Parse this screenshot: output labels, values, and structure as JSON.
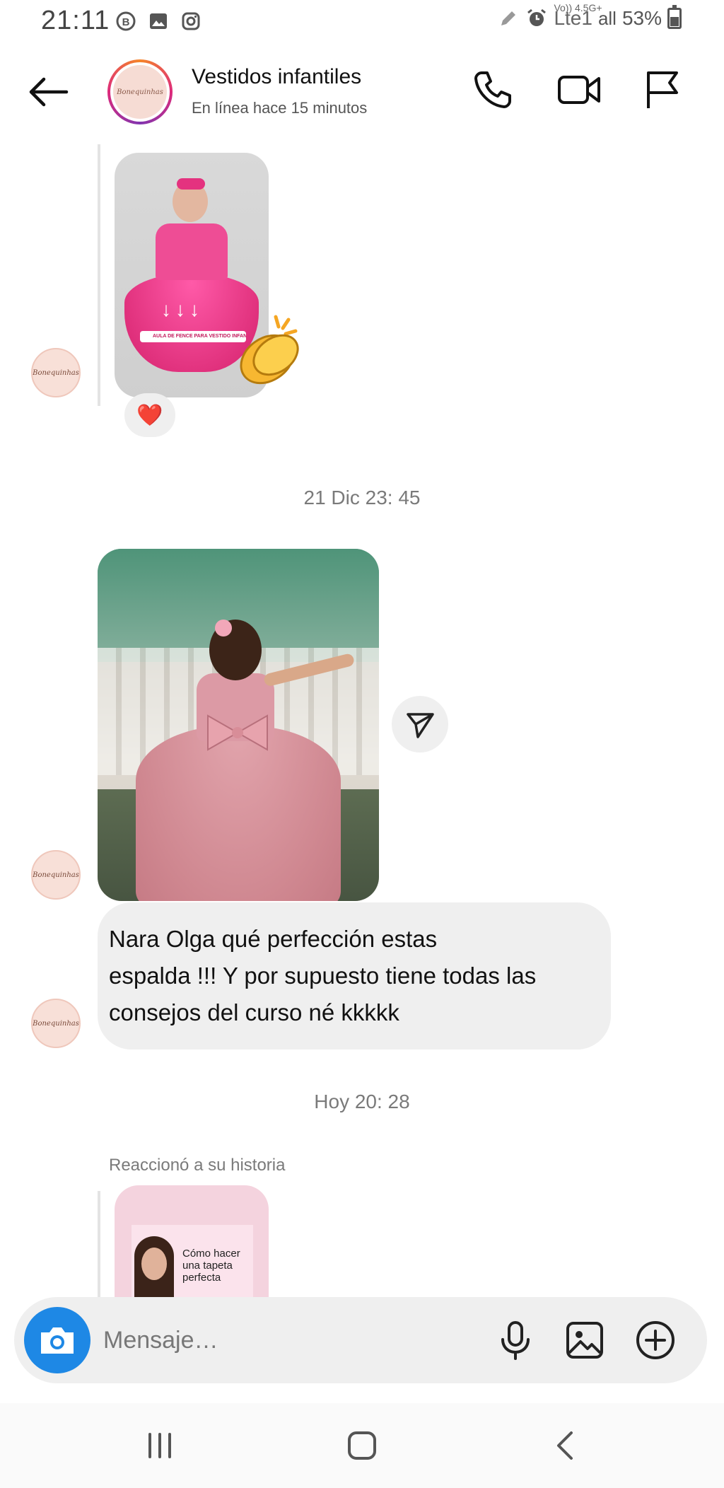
{
  "status_bar": {
    "time": "21:11",
    "network_label": "Vo)) 4.5G+",
    "network_type": "Lte1",
    "signal": "all",
    "battery": "53%",
    "icons": [
      "whatsapp-business-icon",
      "gallery-icon",
      "instagram-icon",
      "pencil-icon",
      "alarm-icon",
      "battery-icon"
    ]
  },
  "header": {
    "title": "Vestidos infantiles",
    "subtitle": "En línea hace 15 minutos",
    "avatar_text": "Bonequinhas",
    "actions": [
      "phone-icon",
      "video-call-icon",
      "flag-icon"
    ]
  },
  "messages": {
    "story_reply_1": {
      "banner_text": "AULA DE FENCE PARA VESTIDO INFANTIL",
      "sticker": "clapping-hands",
      "reaction": "❤️"
    },
    "timestamp_1": "21 Dic 23: 45",
    "text_bubble": {
      "lines": [
        "Nara Olga qué perfección estas",
        "espalda !!! Y por supuesto tiene todas las",
        "consejos del curso né kkkkk"
      ]
    },
    "timestamp_2": "Hoy 20: 28",
    "story_reply_2": {
      "label": "Reaccionó a su historia",
      "card_text": "Cómo hacer una tapeta perfecta"
    }
  },
  "composer": {
    "placeholder": "Mensaje…",
    "icons": [
      "camera-icon",
      "microphone-icon",
      "gallery-icon",
      "add-icon"
    ]
  },
  "navbar": {
    "buttons": [
      "recents-button",
      "home-button",
      "back-button"
    ]
  },
  "colors": {
    "accent_blue": "#1e88e5",
    "bubble_bg": "#efefef",
    "timestamp_text": "#7a7a7a",
    "heart_red": "#e0245e"
  }
}
